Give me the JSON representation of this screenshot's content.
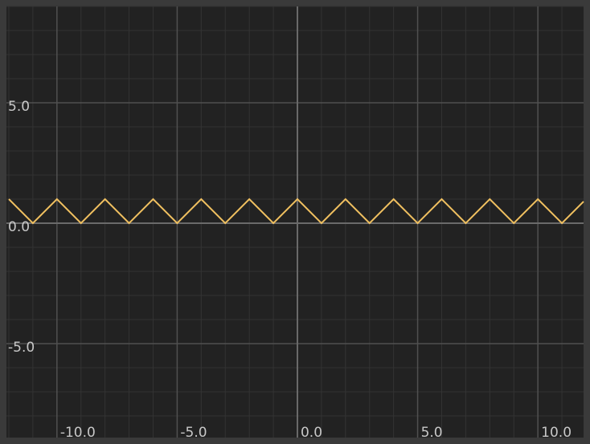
{
  "chart_data": {
    "type": "line",
    "title": "",
    "xlabel": "",
    "ylabel": "",
    "xlim": [
      -12.1,
      11.9
    ],
    "ylim": [
      -8.9,
      9.0
    ],
    "grid": true,
    "x_ticks": [
      {
        "value": -10,
        "label": "-10.0"
      },
      {
        "value": -5,
        "label": "-5.0"
      },
      {
        "value": 0,
        "label": "0.0"
      },
      {
        "value": 5,
        "label": "5.0"
      },
      {
        "value": 10,
        "label": "10.0"
      }
    ],
    "y_ticks": [
      {
        "value": -5,
        "label": "-5.0"
      },
      {
        "value": 0,
        "label": "0.0"
      },
      {
        "value": 5,
        "label": "5.0"
      }
    ],
    "minor_step": 1,
    "series": [
      {
        "x": [
          -12.0,
          -11.0,
          -10.0,
          -9.0,
          -8.0,
          -7.0,
          -6.0,
          -5.0,
          -4.0,
          -3.0,
          -2.0,
          -1.0,
          0.0,
          1.0,
          2.0,
          3.0,
          4.0,
          5.0,
          6.0,
          7.0,
          8.0,
          9.0,
          10.0,
          11.0,
          11.9
        ],
        "y": [
          1,
          0,
          1,
          0,
          1,
          0,
          1,
          0,
          1,
          0,
          1,
          0,
          1,
          0,
          1,
          0,
          1,
          0,
          1,
          0,
          1,
          0,
          1,
          0,
          0.9
        ]
      }
    ],
    "colors": {
      "background": "#222222",
      "frame": "#3a3a3a",
      "grid_minor": "#333333",
      "grid_major": "#505050",
      "axis": "#6a6a6a",
      "line": "#f0c060",
      "tick_text": "#c8c8c8"
    }
  }
}
